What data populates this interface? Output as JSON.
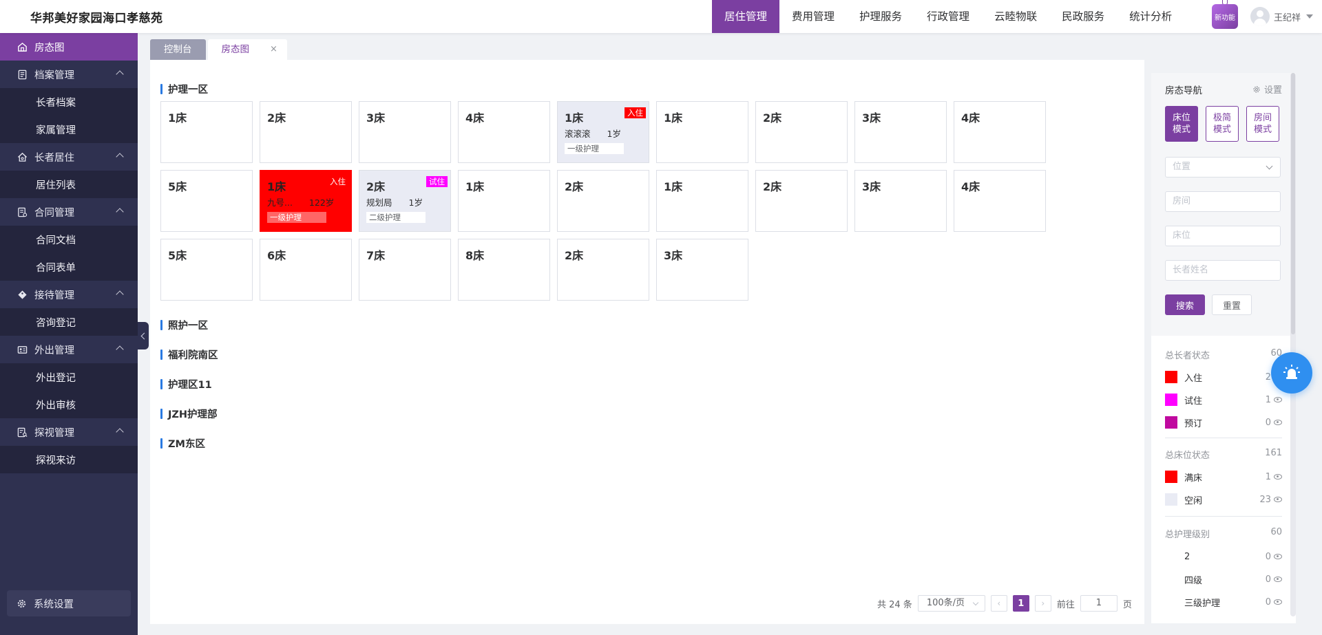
{
  "app": {
    "title": "华邦美好家园海口孝慈苑"
  },
  "topnav": [
    {
      "label": "居住管理",
      "active": true
    },
    {
      "label": "费用管理",
      "active": false
    },
    {
      "label": "护理服务",
      "active": false
    },
    {
      "label": "行政管理",
      "active": false
    },
    {
      "label": "云睦物联",
      "active": false
    },
    {
      "label": "民政服务",
      "active": false
    },
    {
      "label": "统计分析",
      "active": false
    }
  ],
  "newfeature_label": "新功能",
  "user": {
    "name": "王纪祥"
  },
  "sidebar": {
    "items": [
      {
        "label": "房态图",
        "icon": "home-icon",
        "active": true
      },
      {
        "label": "档案管理",
        "icon": "file-icon",
        "subs": [
          "长者档案",
          "家属管理"
        ]
      },
      {
        "label": "长者居住",
        "icon": "house-icon",
        "subs": [
          "居住列表"
        ]
      },
      {
        "label": "合同管理",
        "icon": "contract-icon",
        "subs": [
          "合同文档",
          "合同表单"
        ]
      },
      {
        "label": "接待管理",
        "icon": "tag-icon",
        "subs": [
          "咨询登记"
        ]
      },
      {
        "label": "外出管理",
        "icon": "id-card-icon",
        "subs": [
          "外出登记",
          "外出审核"
        ]
      },
      {
        "label": "探视管理",
        "icon": "visit-icon",
        "subs": [
          "探视来访"
        ]
      }
    ],
    "settings_label": "系统设置"
  },
  "tabs": [
    {
      "label": "控制台"
    },
    {
      "label": "房态图",
      "close": "×"
    }
  ],
  "areas": [
    "护理一区",
    "照护一区",
    "福利院南区",
    "护理区11",
    "JZH护理部",
    "ZM东区"
  ],
  "beds": [
    {
      "name": "1床"
    },
    {
      "name": "2床"
    },
    {
      "name": "3床"
    },
    {
      "name": "4床"
    },
    {
      "name": "1床",
      "tag": "入住",
      "elder": "滚滚滚",
      "age": "1岁",
      "care": "一级护理",
      "status": "occupied",
      "tag_color": "#ff0000"
    },
    {
      "name": "1床"
    },
    {
      "name": "2床"
    },
    {
      "name": "3床"
    },
    {
      "name": "4床"
    },
    {
      "name": "5床"
    },
    {
      "name": "1床",
      "tag": "入住",
      "elder": "九号...",
      "age": "122岁",
      "care": "一级护理",
      "status": "red",
      "tag_color": "#ff0000"
    },
    {
      "name": "2床",
      "tag": "试住",
      "elder": "规划局",
      "age": "1岁",
      "care": "二级护理",
      "status": "occupied",
      "tag_color": "#ff00ff"
    },
    {
      "name": "1床"
    },
    {
      "name": "2床"
    },
    {
      "name": "1床"
    },
    {
      "name": "2床"
    },
    {
      "name": "3床"
    },
    {
      "name": "4床"
    },
    {
      "name": "5床"
    },
    {
      "name": "6床"
    },
    {
      "name": "7床"
    },
    {
      "name": "8床"
    },
    {
      "name": "2床"
    },
    {
      "name": "3床"
    }
  ],
  "pagination": {
    "total": "共 24 条",
    "page_size": "100条/页",
    "current": "1",
    "goto_label": "前往",
    "goto_value": "1",
    "page_unit": "页",
    "prev": "‹",
    "next": "›"
  },
  "nav_panel": {
    "title": "房态导航",
    "settings": "设置",
    "modes": [
      {
        "label": "床位模式",
        "active": true
      },
      {
        "label": "极简模式",
        "active": false
      },
      {
        "label": "房间模式",
        "active": false
      }
    ],
    "location_placeholder": "位置",
    "room_placeholder": "房间",
    "bed_placeholder": "床位",
    "elder_placeholder": "长者姓名",
    "search": "搜索",
    "reset": "重置"
  },
  "stats": {
    "elder_status": {
      "title": "总长者状态",
      "total": "60",
      "items": [
        {
          "label": "入住",
          "count": "2",
          "color": "#ff0000"
        },
        {
          "label": "试住",
          "count": "1",
          "color": "#ff00ff"
        },
        {
          "label": "预订",
          "count": "0",
          "color": "#c0099f"
        }
      ]
    },
    "bed_status": {
      "title": "总床位状态",
      "total": "161",
      "items": [
        {
          "label": "满床",
          "count": "1",
          "color": "#ff0000"
        },
        {
          "label": "空闲",
          "count": "23",
          "color": "#e9ebf4"
        }
      ]
    },
    "care_level": {
      "title": "总护理级别",
      "total": "60",
      "items": [
        {
          "label": "2",
          "count": "0",
          "color": "#ffffff"
        },
        {
          "label": "四级",
          "count": "0",
          "color": "#ffffff"
        },
        {
          "label": "三级护理",
          "count": "0",
          "color": "#ffffff"
        }
      ]
    }
  }
}
